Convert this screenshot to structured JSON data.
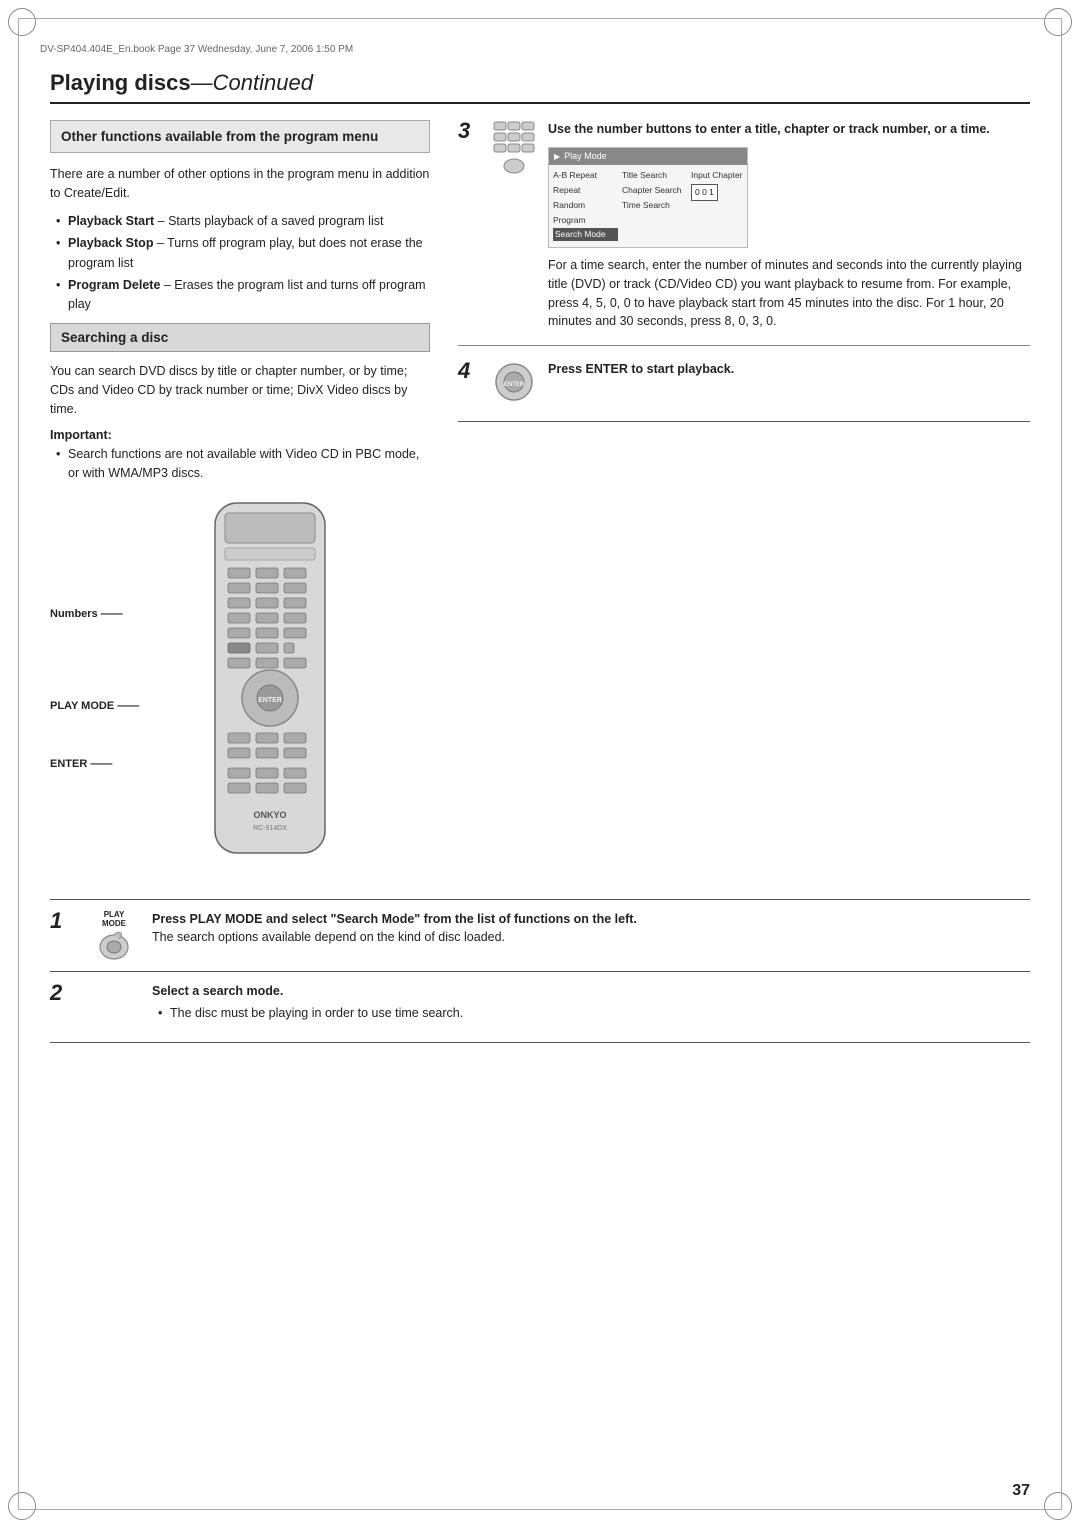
{
  "page": {
    "header_text": "DV-SP404.404E_En.book  Page 37  Wednesday, June 7, 2006  1:50 PM",
    "page_number": "37",
    "main_title": "Playing discs",
    "main_title_continued": "—Continued"
  },
  "left_section": {
    "box1_title": "Other functions available from the program menu",
    "intro_text": "There are a number of other options in the program menu in addition to Create/Edit.",
    "bullets": [
      {
        "label": "Playback Start",
        "text": " – Starts playback of a saved program list"
      },
      {
        "label": "Playback Stop",
        "text": " – Turns off program play, but does not erase the program list"
      },
      {
        "label": "Program Delete",
        "text": " – Erases the program list and turns off program play"
      }
    ],
    "box2_title": "Searching a disc",
    "search_intro": "You can search DVD discs by title or chapter number, or by time; CDs and Video CD by track number or time; DivX Video discs by time.",
    "important_label": "Important:",
    "important_bullets": [
      "Search functions are not available with Video CD in PBC mode, or with WMA/MP3 discs."
    ],
    "label_numbers": "Numbers",
    "label_play_mode": "PLAY MODE",
    "label_enter": "ENTER"
  },
  "right_section": {
    "step3_num": "3",
    "step3_title": "Use the number buttons to enter a title, chapter or track number, or a time.",
    "step3_body": "For a time search, enter the number of minutes and seconds into the currently playing title (DVD) or track (CD/Video CD) you want playback to resume from. For example, press 4, 5, 0, 0 to have playback start from 45 minutes into the disc. For 1 hour, 20 minutes and 30 seconds, press 8, 0, 3, 0.",
    "step4_num": "4",
    "step4_title": "Press ENTER to start playback.",
    "play_mode_screen": {
      "header": "Play Mode",
      "col1_rows": [
        "A-B Repeat",
        "Repeat",
        "Random",
        "Program",
        "Search Mode"
      ],
      "col2_rows": [
        "Title Search",
        "Chapter Search",
        "Time Search"
      ],
      "col3_label": "Input Chapter",
      "col3_value": "0 0 1"
    }
  },
  "bottom_steps": {
    "step1_num": "1",
    "step1_icon_label": "PLAY MODE",
    "step1_title": "Press PLAY MODE and select \"Search Mode\" from the list of functions on the left.",
    "step1_body": "The search options available depend on the kind of disc loaded.",
    "step2_num": "2",
    "step2_title": "Select a search mode.",
    "step2_bullets": [
      "The disc must be playing in order to use time search."
    ]
  }
}
